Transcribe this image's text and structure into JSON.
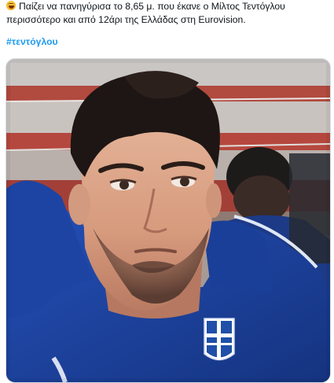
{
  "tweet": {
    "text_line1": "Παίζει να πανηγύρισα το 8,65 μ. που έκανε ο Μίλτος Τεντόγλου",
    "text_line2": "περισσότερο και από 12άρι της Ελλάδας στη Eurovision.",
    "hashtag": "#τεντόγλου",
    "emoji": "laughing-crying-face"
  },
  "media": {
    "kind": "photo",
    "crest_colors": [
      "#1f4fa8",
      "#ffffff"
    ],
    "jacket_color": "#1b3f9e"
  }
}
